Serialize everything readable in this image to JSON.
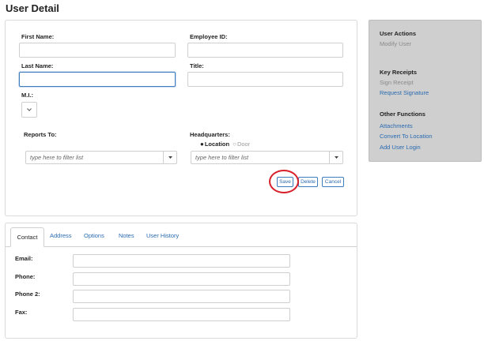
{
  "page": {
    "title": "User Detail"
  },
  "form": {
    "first_name": {
      "label": "First Name:",
      "value": ""
    },
    "employee_id": {
      "label": "Employee ID:",
      "value": ""
    },
    "last_name": {
      "label": "Last Name:",
      "value": ""
    },
    "title": {
      "label": "Title:",
      "value": ""
    },
    "mi": {
      "label": "M.I.:",
      "value": ""
    },
    "reports_to": {
      "label": "Reports To:",
      "placeholder": "type here to filter list"
    },
    "headquarters": {
      "label": "Headquarters:",
      "placeholder": "type here to filter list",
      "radio_selected": "Location",
      "radio_other": "Door"
    },
    "buttons": {
      "save": "Save",
      "delete": "Delete",
      "cancel": "Cancel"
    }
  },
  "sidebar": {
    "user_actions": {
      "heading": "User Actions",
      "items": [
        "Modify User"
      ]
    },
    "key_receipts": {
      "heading": "Key Receipts",
      "items": [
        "Sign Receipt",
        "Request Signature"
      ]
    },
    "other_functions": {
      "heading": "Other Functions",
      "items": [
        "Attachments",
        "Convert To Location",
        "Add User Login"
      ]
    }
  },
  "tabs": [
    "Contact",
    "Address",
    "Options",
    "Notes",
    "User History"
  ],
  "active_tab": "Contact",
  "contact": {
    "email": {
      "label": "Email:",
      "value": ""
    },
    "phone": {
      "label": "Phone:",
      "value": ""
    },
    "phone2": {
      "label": "Phone 2:",
      "value": ""
    },
    "fax": {
      "label": "Fax:",
      "value": ""
    }
  },
  "colors": {
    "link": "#2a6ab0",
    "focus_border": "#3d7dc0",
    "sidebar_bg": "#cfcfcf",
    "highlight_circle": "#d8202b"
  }
}
